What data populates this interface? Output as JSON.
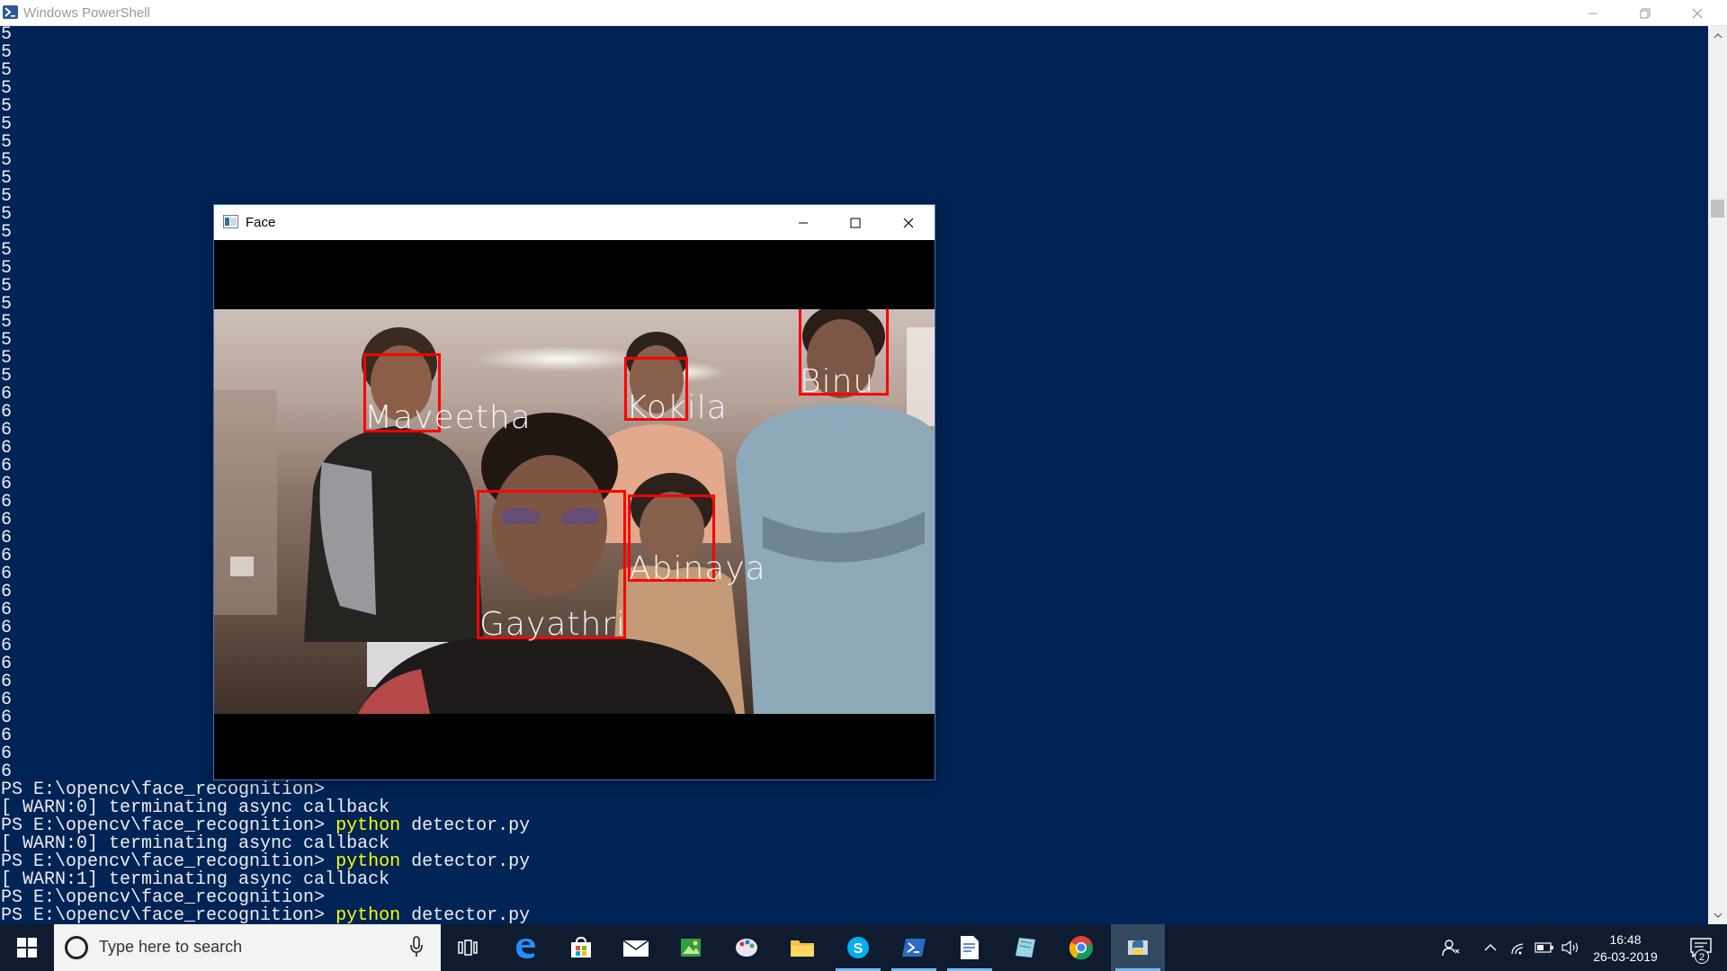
{
  "window": {
    "title": "Windows PowerShell",
    "icon": "powershell-icon"
  },
  "console": {
    "count_lines": [
      "5",
      "5",
      "5",
      "5",
      "5",
      "5",
      "5",
      "5",
      "5",
      "5",
      "5",
      "5",
      "5",
      "5",
      "5",
      "5",
      "5",
      "5",
      "5",
      "5",
      "6",
      "6",
      "6",
      "6",
      "6",
      "6",
      "6",
      "6",
      "6",
      "6",
      "6",
      "6",
      "6",
      "6",
      "6",
      "6",
      "6",
      "6",
      "6",
      "6",
      "6",
      "6"
    ],
    "prompt_lines": [
      {
        "prefix": "PS E:\\opencv\\face_recognition>",
        "cmd": "",
        "rest": ""
      },
      {
        "prefix": "[ WARN:0] terminating async callback",
        "cmd": "",
        "rest": ""
      },
      {
        "prefix": "PS E:\\opencv\\face_recognition> ",
        "cmd": "python",
        "rest": " detector.py"
      },
      {
        "prefix": "[ WARN:0] terminating async callback",
        "cmd": "",
        "rest": ""
      },
      {
        "prefix": "PS E:\\opencv\\face_recognition> ",
        "cmd": "python",
        "rest": " detector.py"
      },
      {
        "prefix": "[ WARN:1] terminating async callback",
        "cmd": "",
        "rest": ""
      },
      {
        "prefix": "PS E:\\opencv\\face_recognition>",
        "cmd": "",
        "rest": ""
      },
      {
        "prefix": "PS E:\\opencv\\face_recognition> ",
        "cmd": "python",
        "rest": " detector.py"
      }
    ],
    "colors": {
      "background": "#012456",
      "text": "#eeedf0",
      "command": "#ffff00"
    }
  },
  "face_window": {
    "title": "Face",
    "labels": {
      "maveetha": "Maveetha",
      "kokila": "Kokila",
      "binu": "Binu",
      "gayathri": "Gayathri",
      "abinaya": "Abinaya"
    },
    "box_color": "#ff0000"
  },
  "taskbar": {
    "search_placeholder": "Type here to search",
    "apps": [
      "task-view-icon",
      "edge-icon",
      "store-icon",
      "mail-icon",
      "photos-icon",
      "paint-icon",
      "file-explorer-icon",
      "skype-icon",
      "powershell-icon",
      "notepad-icon",
      "paper-icon",
      "chrome-icon",
      "python-icon"
    ],
    "clock_time": "16:48",
    "clock_date": "26-03-2019",
    "notification_count": "2"
  }
}
